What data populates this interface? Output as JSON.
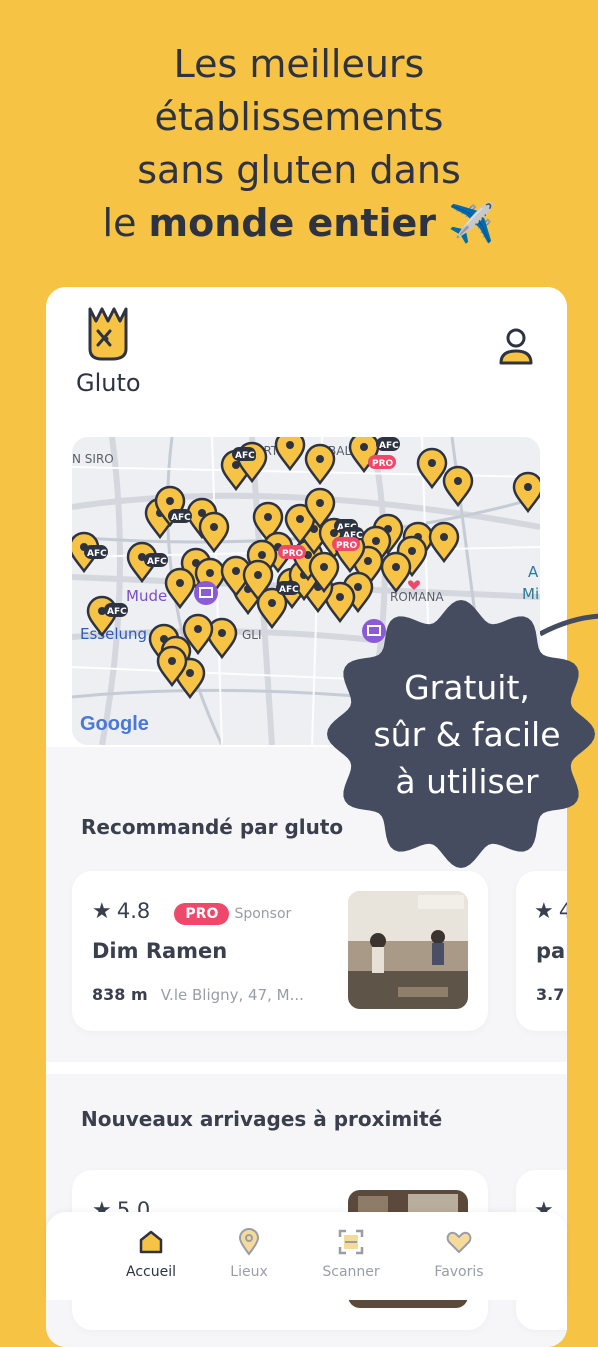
{
  "headline": {
    "line1": "Les meilleurs",
    "line2": "établissements",
    "line3": "sans gluten dans",
    "line4_prefix": "le ",
    "line4_bold": "monde entier",
    "emoji": "✈️"
  },
  "app": {
    "logo_text": "Gluto"
  },
  "map": {
    "labels": [
      "N SIRO",
      "Mude",
      "Esselung",
      "GLI",
      "ROMANA",
      "A",
      "Mi",
      "PRO",
      "AFC",
      "ORT",
      "BAL"
    ],
    "attribution": "Google"
  },
  "bubble": {
    "line1": "Gratuit,",
    "line2": "sûr & facile",
    "line3": "à utiliser"
  },
  "recommended": {
    "title": "Recommandé par gluto",
    "card": {
      "rating": "4.8",
      "badge": "PRO",
      "sponsor": "Sponsor",
      "name": "Dim Ramen",
      "distance": "838 m",
      "address": "V.le Bligny, 47, M..."
    },
    "peek": {
      "rating": "4",
      "name": "pa",
      "distance": "3.7"
    }
  },
  "nearby": {
    "title": "Nouveaux arrivages à proximité",
    "card": {
      "rating": "5.0"
    }
  },
  "nav": {
    "items": [
      {
        "label": "Accueil",
        "icon": "home-icon"
      },
      {
        "label": "Lieux",
        "icon": "location-icon"
      },
      {
        "label": "Scanner",
        "icon": "scanner-icon"
      },
      {
        "label": "Favoris",
        "icon": "heart-icon"
      }
    ]
  },
  "colors": {
    "brand_yellow": "#F6C344",
    "dark": "#2E3342",
    "pro_pink": "#F0486A"
  }
}
